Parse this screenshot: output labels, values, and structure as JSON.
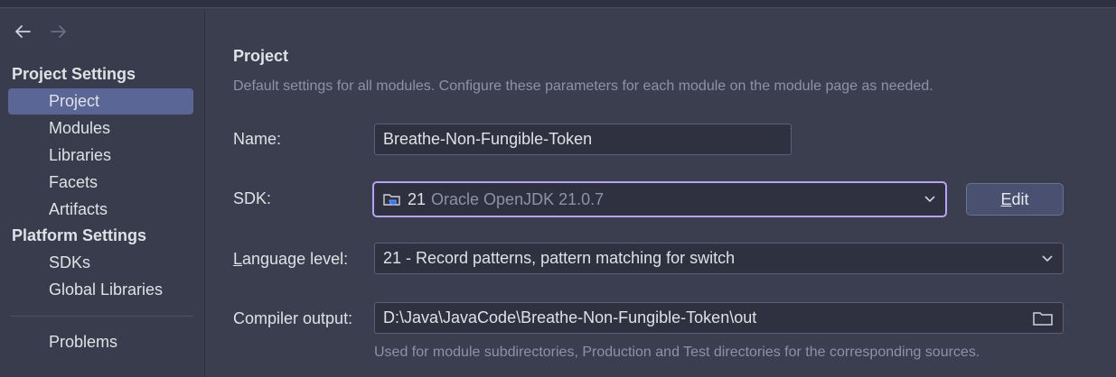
{
  "sidebar": {
    "project_settings_title": "Project Settings",
    "platform_settings_title": "Platform Settings",
    "project_items": [
      {
        "label": "Project"
      },
      {
        "label": "Modules"
      },
      {
        "label": "Libraries"
      },
      {
        "label": "Facets"
      },
      {
        "label": "Artifacts"
      }
    ],
    "platform_items": [
      {
        "label": "SDKs"
      },
      {
        "label": "Global Libraries"
      }
    ],
    "problems_label": "Problems"
  },
  "main": {
    "title": "Project",
    "description": "Default settings for all modules. Configure these parameters for each module on the module page as needed.",
    "name_label": "Name:",
    "name_value": "Breathe-Non-Fungible-Token",
    "sdk_label": "SDK:",
    "sdk_version": "21",
    "sdk_name": "Oracle OpenJDK 21.0.7",
    "edit_button_first": "E",
    "edit_button_rest": "dit",
    "language_label_first": "L",
    "language_label_rest": "anguage level:",
    "language_value": "21 - Record patterns, pattern matching for switch",
    "compiler_label": "Compiler output:",
    "compiler_value": "D:\\Java\\JavaCode\\Breathe-Non-Fungible-Token\\out",
    "compiler_hint": "Used for module subdirectories, Production and Test directories for the corresponding sources."
  },
  "colors": {
    "background": "#3b3e4f",
    "selected": "#5a6796",
    "focus_border": "#b8a3f0",
    "muted_text": "#8e92a6"
  }
}
